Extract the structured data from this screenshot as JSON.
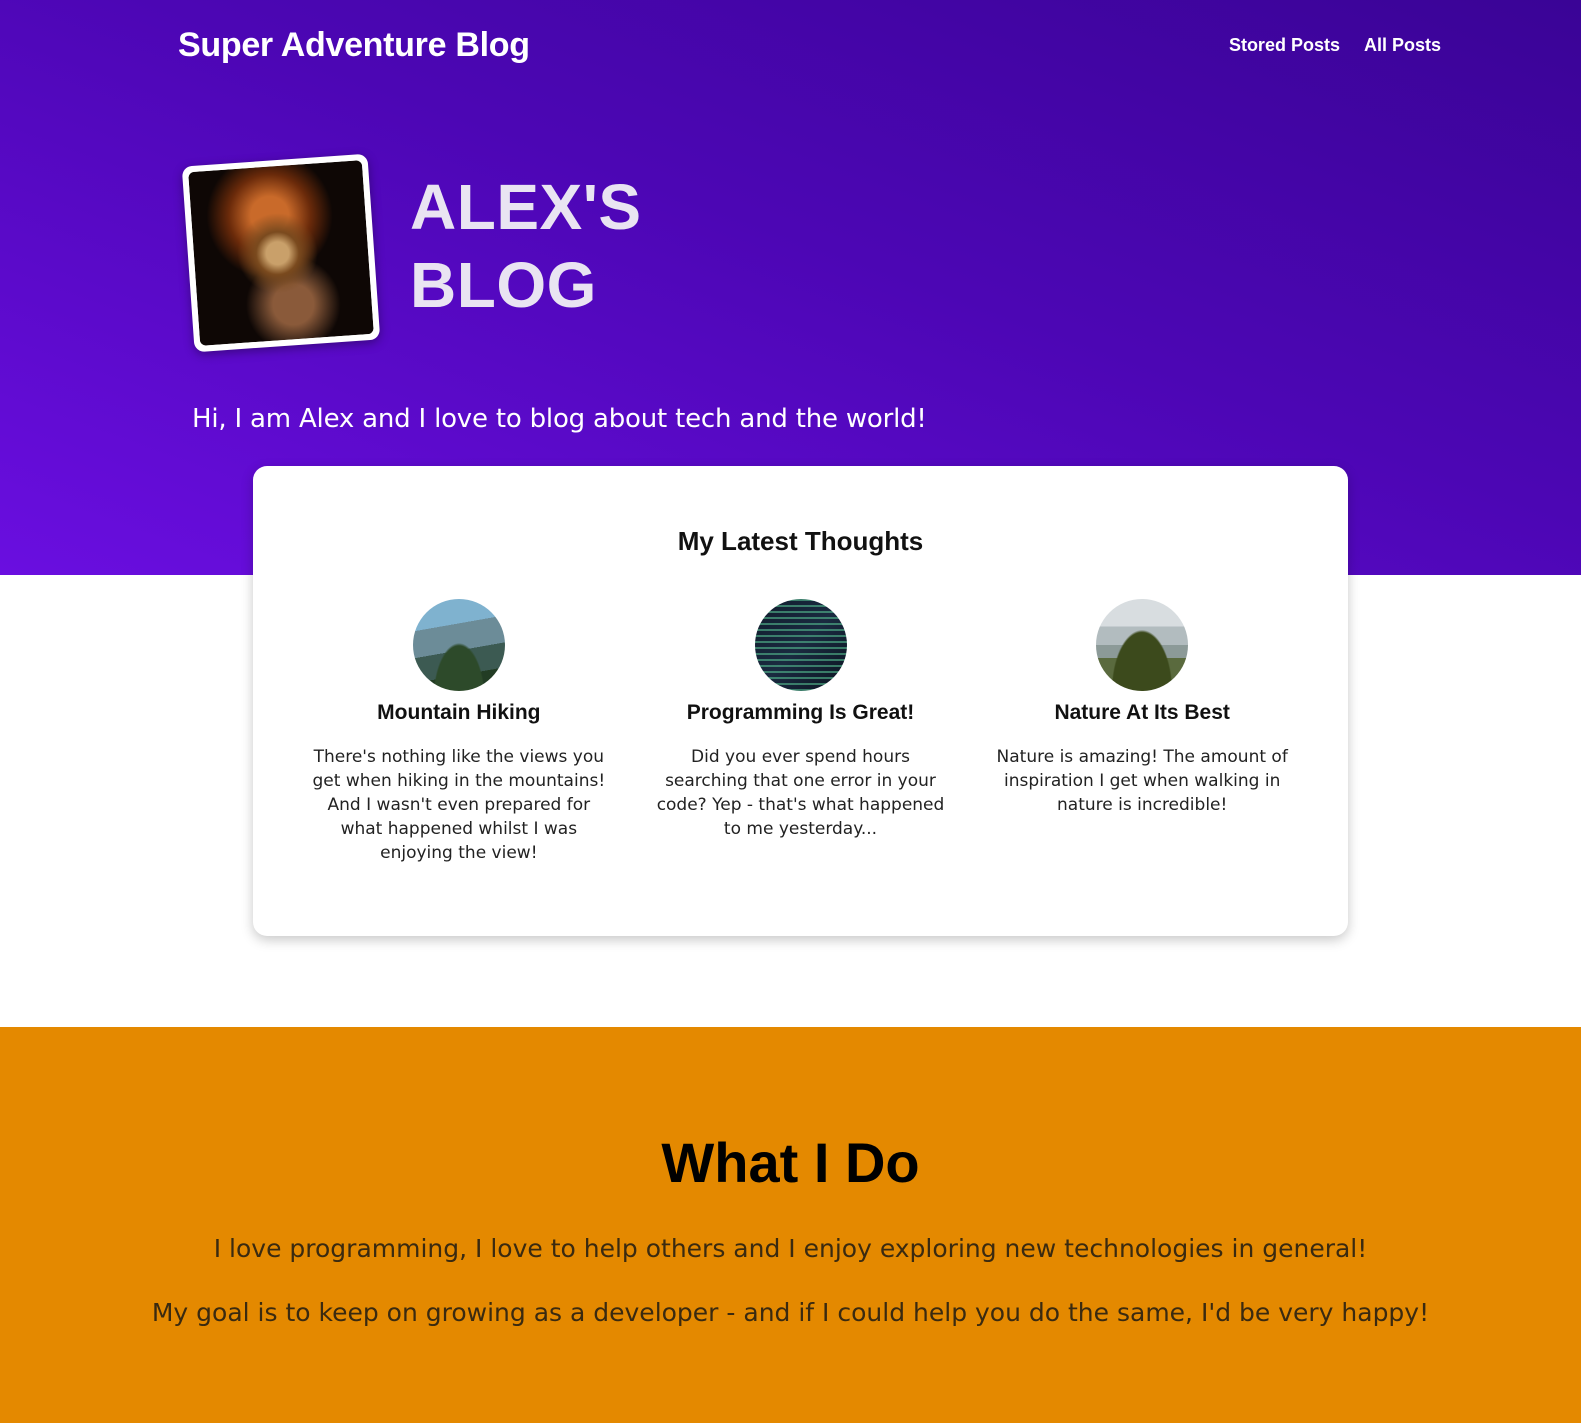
{
  "header": {
    "brand": "Super Adventure Blog",
    "nav": [
      {
        "label": "Stored Posts"
      },
      {
        "label": "All Posts"
      }
    ]
  },
  "hero": {
    "title_line1": "ALEX'S",
    "title_line2": "BLOG",
    "intro": "Hi, I am Alex and I love to blog about tech and the world!",
    "colors": {
      "gradient_dark": "#3a0496",
      "gradient_light": "#6a0ee0"
    }
  },
  "latest": {
    "title": "My Latest Thoughts",
    "posts": [
      {
        "title": "Mountain Hiking",
        "text": "There's nothing like the views you get when hiking in the mountains! And I wasn't even prepared for what happened whilst I was enjoying the view!",
        "icon": "mountain-photo"
      },
      {
        "title": "Programming Is Great!",
        "text": "Did you ever spend hours searching that one error in your code? Yep - that's what happened to me yesterday...",
        "icon": "code-photo"
      },
      {
        "title": "Nature At Its Best",
        "text": "Nature is amazing! The amount of inspiration I get when walking in nature is incredible!",
        "icon": "forest-photo"
      }
    ]
  },
  "what_i_do": {
    "title": "What I Do",
    "paragraph1": "I love programming, I love to help others and I enjoy exploring new technologies in general!",
    "paragraph2": "My goal is to keep on growing as a developer - and if I could help you do the same, I'd be very happy!",
    "background_color": "#e48900"
  }
}
